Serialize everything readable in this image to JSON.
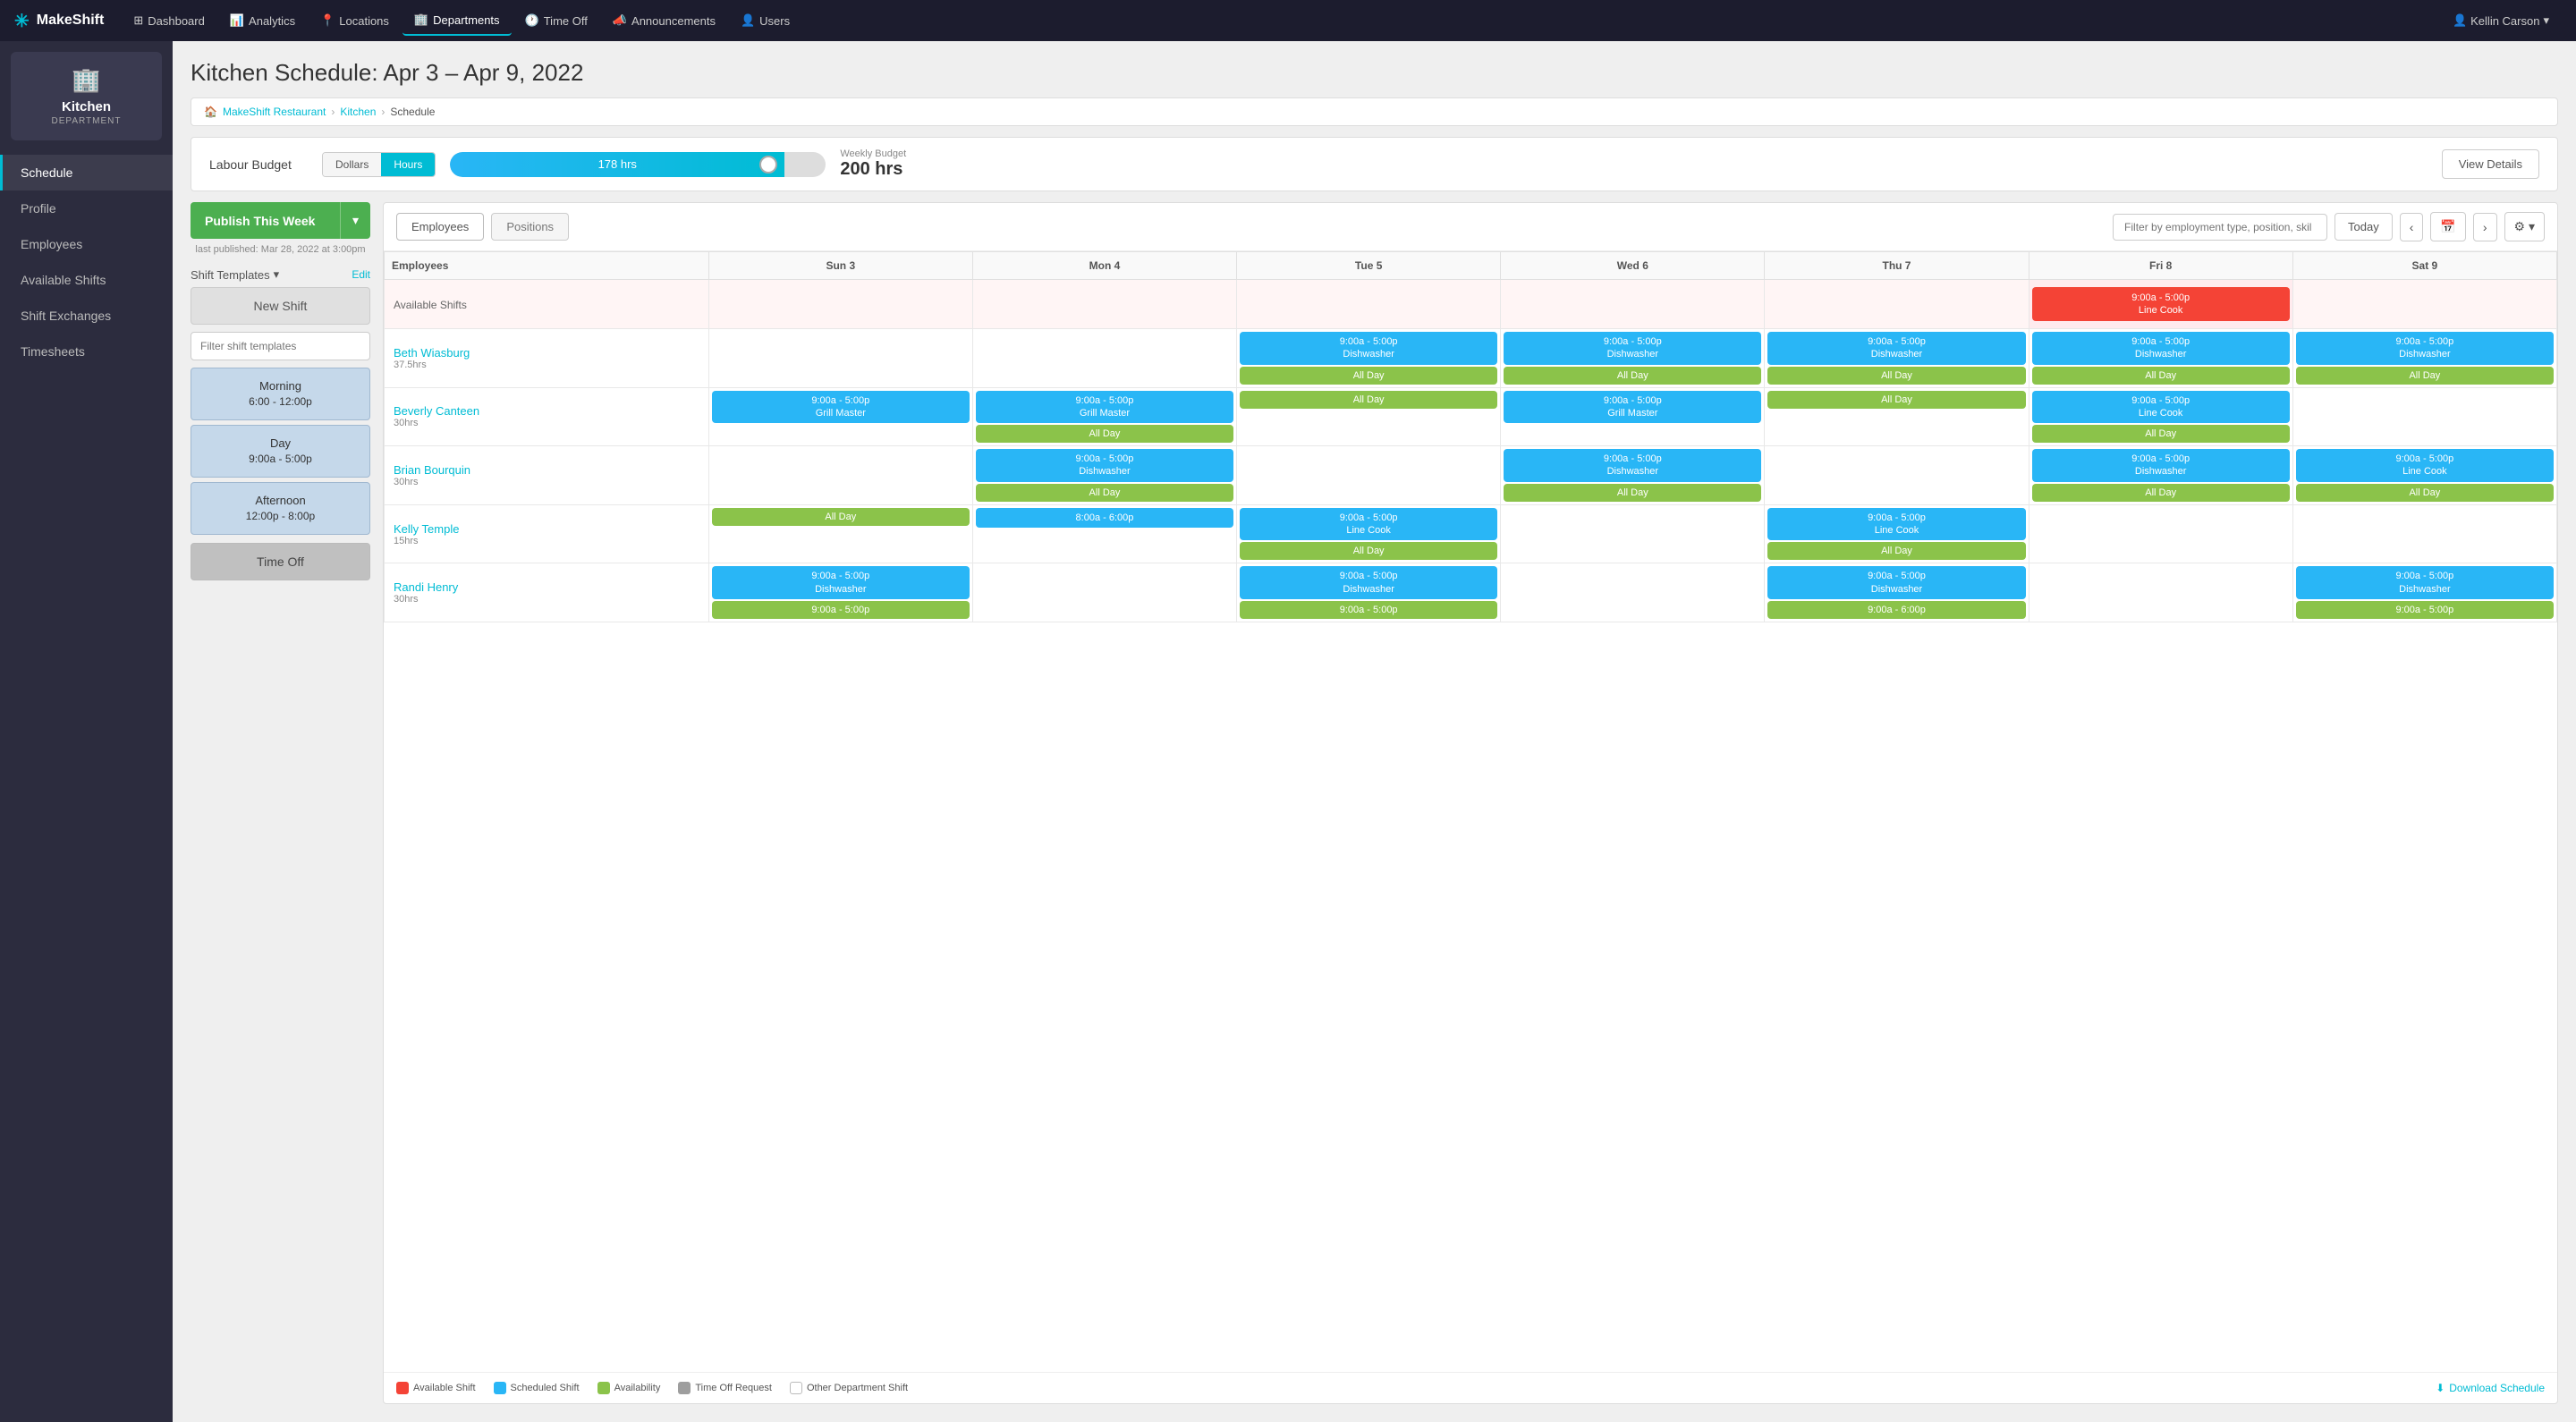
{
  "topNav": {
    "brand": "MakeShift",
    "items": [
      {
        "id": "dashboard",
        "label": "Dashboard",
        "icon": "⊞",
        "active": false
      },
      {
        "id": "analytics",
        "label": "Analytics",
        "icon": "📊",
        "active": false
      },
      {
        "id": "locations",
        "label": "Locations",
        "icon": "📍",
        "active": false
      },
      {
        "id": "departments",
        "label": "Departments",
        "icon": "🏢",
        "active": true
      },
      {
        "id": "timeoff",
        "label": "Time Off",
        "icon": "🕐",
        "active": false
      },
      {
        "id": "announcements",
        "label": "Announcements",
        "icon": "📣",
        "active": false
      },
      {
        "id": "users",
        "label": "Users",
        "icon": "👤",
        "active": false
      }
    ],
    "user": "Kellin Carson"
  },
  "sidebar": {
    "dept": {
      "icon": "🏢",
      "name": "Kitchen",
      "label": "DEPARTMENT"
    },
    "navItems": [
      {
        "id": "schedule",
        "label": "Schedule",
        "active": true
      },
      {
        "id": "profile",
        "label": "Profile",
        "active": false
      },
      {
        "id": "employees",
        "label": "Employees",
        "active": false
      },
      {
        "id": "available-shifts",
        "label": "Available Shifts",
        "active": false
      },
      {
        "id": "shift-exchanges",
        "label": "Shift Exchanges",
        "active": false
      },
      {
        "id": "timesheets",
        "label": "Timesheets",
        "active": false
      }
    ]
  },
  "page": {
    "title": "Kitchen Schedule: Apr 3 – Apr 9, 2022"
  },
  "breadcrumb": {
    "home": "MakeShift Restaurant",
    "dept": "Kitchen",
    "current": "Schedule"
  },
  "labourBudget": {
    "label": "Labour Budget",
    "dollarsLabel": "Dollars",
    "hoursLabel": "Hours",
    "filledHrs": "178 hrs",
    "fillPercent": 89,
    "weeklyBudgetLabel": "Weekly Budget",
    "weeklyBudgetValue": "200 hrs",
    "viewDetailsLabel": "View Details"
  },
  "scheduleToolbar": {
    "tabEmployees": "Employees",
    "tabPositions": "Positions",
    "filterPlaceholder": "Filter by employment type, position, skil",
    "todayLabel": "Today"
  },
  "scheduleTable": {
    "columns": [
      "Employees",
      "Sun 3",
      "Mon 4",
      "Tue 5",
      "Wed 6",
      "Thu 7",
      "Fri 8",
      "Sat 9"
    ],
    "availableShiftsRow": {
      "label": "Available Shifts",
      "cells": [
        {
          "day": "sun",
          "shifts": []
        },
        {
          "day": "mon",
          "shifts": []
        },
        {
          "day": "tue",
          "shifts": []
        },
        {
          "day": "wed",
          "shifts": []
        },
        {
          "day": "thu",
          "shifts": []
        },
        {
          "day": "fri",
          "type": "red",
          "shifts": [
            {
              "time": "9:00a - 5:00p",
              "role": "Line Cook"
            }
          ]
        },
        {
          "day": "sat",
          "shifts": []
        }
      ]
    },
    "employees": [
      {
        "name": "Beth Wiasburg",
        "hours": "37.5hrs",
        "cells": [
          {
            "day": "sun",
            "shifts": []
          },
          {
            "day": "mon",
            "shifts": []
          },
          {
            "day": "tue",
            "shifts": [
              {
                "type": "blue",
                "time": "9:00a - 5:00p",
                "role": "Dishwasher"
              },
              {
                "type": "green",
                "time": "All Day"
              }
            ]
          },
          {
            "day": "wed",
            "shifts": [
              {
                "type": "blue",
                "time": "9:00a - 5:00p",
                "role": "Dishwasher"
              },
              {
                "type": "green",
                "time": "All Day"
              }
            ]
          },
          {
            "day": "thu",
            "shifts": [
              {
                "type": "blue",
                "time": "9:00a - 5:00p",
                "role": "Dishwasher"
              },
              {
                "type": "green",
                "time": "All Day"
              }
            ]
          },
          {
            "day": "fri",
            "shifts": [
              {
                "type": "blue",
                "time": "9:00a - 5:00p",
                "role": "Dishwasher"
              },
              {
                "type": "green",
                "time": "All Day"
              }
            ]
          },
          {
            "day": "sat",
            "shifts": [
              {
                "type": "blue",
                "time": "9:00a - 5:00p",
                "role": "Dishwasher"
              },
              {
                "type": "green",
                "time": "All Day"
              }
            ]
          }
        ]
      },
      {
        "name": "Beverly Canteen",
        "hours": "30hrs",
        "cells": [
          {
            "day": "sun",
            "shifts": [
              {
                "type": "blue",
                "time": "9:00a - 5:00p",
                "role": "Grill Master"
              }
            ]
          },
          {
            "day": "mon",
            "shifts": [
              {
                "type": "blue",
                "time": "9:00a - 5:00p",
                "role": "Grill Master"
              },
              {
                "type": "green",
                "time": "All Day"
              }
            ]
          },
          {
            "day": "tue",
            "shifts": [
              {
                "type": "green",
                "time": "All Day"
              }
            ]
          },
          {
            "day": "wed",
            "shifts": [
              {
                "type": "blue",
                "time": "9:00a - 5:00p",
                "role": "Grill Master"
              }
            ]
          },
          {
            "day": "thu",
            "shifts": [
              {
                "type": "green",
                "time": "All Day"
              }
            ]
          },
          {
            "day": "fri",
            "shifts": [
              {
                "type": "blue",
                "time": "9:00a - 5:00p",
                "role": "Line Cook"
              },
              {
                "type": "green",
                "time": "All Day"
              }
            ]
          },
          {
            "day": "sat",
            "shifts": []
          }
        ]
      },
      {
        "name": "Brian Bourquin",
        "hours": "30hrs",
        "cells": [
          {
            "day": "sun",
            "shifts": []
          },
          {
            "day": "mon",
            "shifts": [
              {
                "type": "blue",
                "time": "9:00a - 5:00p",
                "role": "Dishwasher"
              },
              {
                "type": "green",
                "time": "All Day"
              }
            ]
          },
          {
            "day": "tue",
            "shifts": []
          },
          {
            "day": "wed",
            "shifts": [
              {
                "type": "blue",
                "time": "9:00a - 5:00p",
                "role": "Dishwasher"
              },
              {
                "type": "green",
                "time": "All Day"
              }
            ]
          },
          {
            "day": "thu",
            "shifts": []
          },
          {
            "day": "fri",
            "shifts": [
              {
                "type": "blue",
                "time": "9:00a - 5:00p",
                "role": "Dishwasher"
              },
              {
                "type": "green",
                "time": "All Day"
              }
            ]
          },
          {
            "day": "sat",
            "shifts": [
              {
                "type": "blue",
                "time": "9:00a - 5:00p",
                "role": "Line Cook"
              },
              {
                "type": "green",
                "time": "All Day"
              }
            ]
          }
        ]
      },
      {
        "name": "Kelly Temple",
        "hours": "15hrs",
        "cells": [
          {
            "day": "sun",
            "shifts": [
              {
                "type": "green",
                "time": "All Day"
              }
            ]
          },
          {
            "day": "mon",
            "shifts": [
              {
                "type": "blue",
                "time": "8:00a - 6:00p"
              }
            ]
          },
          {
            "day": "tue",
            "shifts": [
              {
                "type": "blue",
                "time": "9:00a - 5:00p",
                "role": "Line Cook"
              },
              {
                "type": "green",
                "time": "All Day"
              }
            ]
          },
          {
            "day": "wed",
            "shifts": []
          },
          {
            "day": "thu",
            "shifts": [
              {
                "type": "blue",
                "time": "9:00a - 5:00p",
                "role": "Line Cook"
              },
              {
                "type": "green",
                "time": "All Day"
              }
            ]
          },
          {
            "day": "fri",
            "shifts": []
          },
          {
            "day": "sat",
            "shifts": []
          }
        ]
      },
      {
        "name": "Randi Henry",
        "hours": "30hrs",
        "cells": [
          {
            "day": "sun",
            "shifts": [
              {
                "type": "blue",
                "time": "9:00a - 5:00p",
                "role": "Dishwasher"
              },
              {
                "type": "green",
                "time": "9:00a - 5:00p"
              }
            ]
          },
          {
            "day": "mon",
            "shifts": []
          },
          {
            "day": "tue",
            "shifts": [
              {
                "type": "blue",
                "time": "9:00a - 5:00p",
                "role": "Dishwasher"
              },
              {
                "type": "green",
                "time": "9:00a - 5:00p"
              }
            ]
          },
          {
            "day": "wed",
            "shifts": []
          },
          {
            "day": "thu",
            "shifts": [
              {
                "type": "blue",
                "time": "9:00a - 5:00p",
                "role": "Dishwasher"
              },
              {
                "type": "green",
                "time": "9:00a - 6:00p"
              }
            ]
          },
          {
            "day": "fri",
            "shifts": []
          },
          {
            "day": "sat",
            "shifts": [
              {
                "type": "blue",
                "time": "9:00a - 5:00p",
                "role": "Dishwasher"
              },
              {
                "type": "green",
                "time": "9:00a - 5:00p"
              }
            ]
          }
        ]
      }
    ]
  },
  "legend": {
    "availableShift": "Available Shift",
    "scheduledShift": "Scheduled Shift",
    "availability": "Availability",
    "timeOffRequest": "Time Off Request",
    "otherDeptShift": "Other Department Shift",
    "downloadLabel": "Download Schedule"
  },
  "leftPanel": {
    "publishLabel": "Publish This Week",
    "lastPublished": "last published: Mar 28, 2022 at 3:00pm",
    "shiftTemplatesLabel": "Shift Templates",
    "editLabel": "Edit",
    "newShiftLabel": "New Shift",
    "filterPlaceholder": "Filter shift templates",
    "templates": [
      {
        "id": "morning",
        "name": "Morning",
        "time": "6:00 - 12:00p",
        "selected": true
      },
      {
        "id": "day",
        "name": "Day",
        "time": "9:00a - 5:00p",
        "selected": false
      },
      {
        "id": "afternoon",
        "name": "Afternoon",
        "time": "12:00p - 8:00p",
        "selected": false
      }
    ],
    "timeOffLabel": "Time Off"
  }
}
